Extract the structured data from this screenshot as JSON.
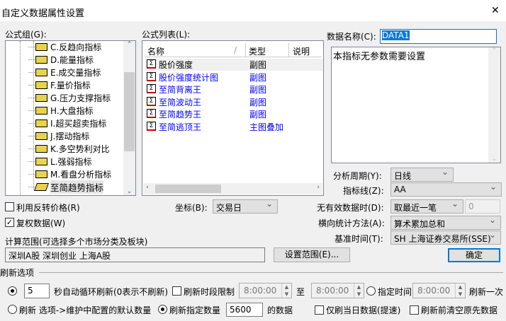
{
  "window": {
    "title": "自定义数据属性设置",
    "close": "✕"
  },
  "formula_group": {
    "label": "公式组(G):",
    "items": [
      "C.反趋向指标",
      "D.能量指标",
      "E.成交量指标",
      "F.量价指标",
      "G.压力支撑指标",
      "H.大盘指标",
      "I.超买超卖指标",
      "J.摆动指标",
      "K.多空势利对比",
      "L.强弱指标",
      "M.看盘分析指标",
      "至简趋势指标"
    ]
  },
  "formula_list": {
    "label": "公式列表(L):",
    "columns": [
      "名称",
      "类型",
      "说明"
    ],
    "rows": [
      {
        "name": "股价强度",
        "type": "副图"
      },
      {
        "name": "股价强度统计图",
        "type": "副图"
      },
      {
        "name": "至简背离王",
        "type": "副图"
      },
      {
        "name": "至简波动王",
        "type": "副图"
      },
      {
        "name": "至简趋势王",
        "type": "副图"
      },
      {
        "name": "至简逃顶王",
        "type": "主图叠加"
      }
    ]
  },
  "data_name": {
    "label": "数据名称(C):",
    "value": "DATA1"
  },
  "params_text": "本指标无参数需要设置",
  "period": {
    "label": "分析周期(Y):",
    "value": "日线"
  },
  "indicator_line": {
    "label": "指标线(Z):",
    "value": "AA"
  },
  "reverse_price": {
    "label": "利用反转价格(R)",
    "checked": false
  },
  "axis": {
    "label": "坐标(B):",
    "value": "交易日"
  },
  "no_data": {
    "label": "无有效数据时(D):",
    "value": "取最近一笔",
    "extra": "0"
  },
  "adjusted": {
    "label": "复权数据(W)",
    "checked": true
  },
  "horizontal": {
    "label": "横向统计方法(A):",
    "value": "算术累加总和"
  },
  "calc_range": {
    "label": "计算范围(可选择多个市场分类及板块)",
    "value": "深圳A股  深圳创业  上海A股",
    "button": "设置范围(E)..."
  },
  "base_time": {
    "label": "基准时间(T):",
    "value": "SH 上海证券交易所(SSE)"
  },
  "ok": "确定",
  "refresh": {
    "title": "刷新选项",
    "interval": "5",
    "interval_text": "秒自动循环刷新(0表示不刷新)",
    "period_limit": "刷新时段限制",
    "from": "8:00:00",
    "to_label": "至",
    "to": "8:00:00",
    "specified_time": "指定时间",
    "time": "8:00:00",
    "once": "刷新一次",
    "default_refresh": "刷新 选项->维护中配置的默认数量",
    "specified_count": "刷新指定数量",
    "count": "5600",
    "count_suffix": "的数据",
    "today_only": "仅刷当日数据(提速)",
    "clear_before": "刷新前清空原先数据"
  }
}
